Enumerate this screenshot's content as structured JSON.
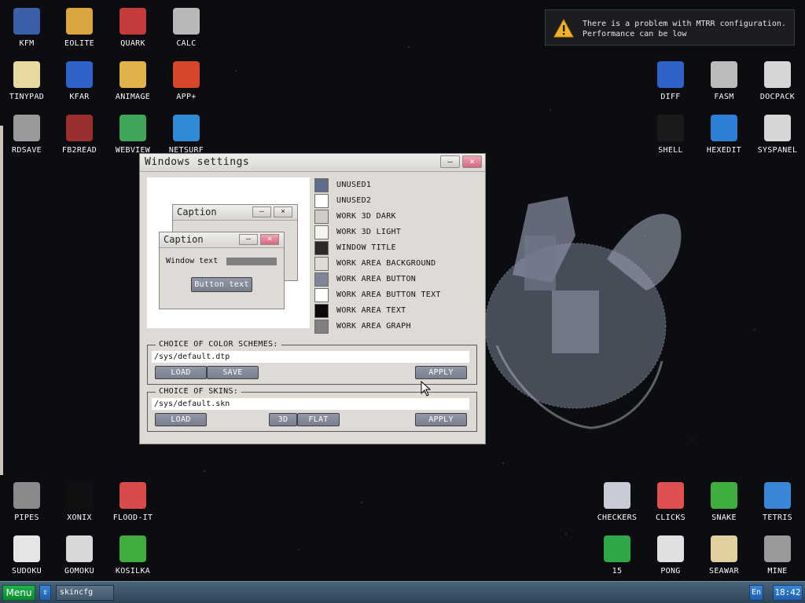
{
  "desktop": {
    "left_top_icons": [
      {
        "label": "KFM",
        "icon": "floppy-disk-icon",
        "color": "#3b5fa8"
      },
      {
        "label": "EOLITE",
        "icon": "folder-icon",
        "color": "#d9a640"
      },
      {
        "label": "QUARK",
        "icon": "notebook-icon",
        "color": "#c53a3a"
      },
      {
        "label": "CALC",
        "icon": "calculator-icon",
        "color": "#b8b8b8"
      },
      {
        "label": "TINYPAD",
        "icon": "notepad-icon",
        "color": "#e8d9a0"
      },
      {
        "label": "KFAR",
        "icon": "file-manager-icon",
        "color": "#2d63c8"
      },
      {
        "label": "ANIMAGE",
        "icon": "pencil-ruler-icon",
        "color": "#e0b24a"
      },
      {
        "label": "APP+",
        "icon": "rubiks-cube-icon",
        "color": "#d9472b"
      },
      {
        "label": "RDSAVE",
        "icon": "ramdisk-save-icon",
        "color": "#9a9a9a"
      },
      {
        "label": "FB2READ",
        "icon": "book-icon",
        "color": "#9a2f2f"
      },
      {
        "label": "WEBVIEW",
        "icon": "webview-map-icon",
        "color": "#3fa65a"
      },
      {
        "label": "NETSURF",
        "icon": "globe-icon",
        "color": "#2f8ad8"
      }
    ],
    "right_top_icons": [
      {
        "label": "DIFF",
        "icon": "diff-icon",
        "color": "#2d63c8"
      },
      {
        "label": "FASM",
        "icon": "fasm-icon",
        "color": "#bcbcbc"
      },
      {
        "label": "DOCPACK",
        "icon": "cabinet-icon",
        "color": "#d6d6d6"
      },
      {
        "label": "SHELL",
        "icon": "terminal-icon",
        "color": "#1a1a1a"
      },
      {
        "label": "HEXEDIT",
        "icon": "hex-editor-icon",
        "color": "#2d7fd8"
      },
      {
        "label": "SYSPANEL",
        "icon": "sliders-icon",
        "color": "#d6d6d6"
      }
    ],
    "bottom_left_icons": [
      {
        "label": "PIPES",
        "icon": "pipes-icon",
        "color": "#8a8a8a"
      },
      {
        "label": "XONIX",
        "icon": "xonix-icon",
        "color": "#101010"
      },
      {
        "label": "FLOOD-IT",
        "icon": "flood-it-icon",
        "color": "#d94b4b"
      },
      {
        "label": "SUDOKU",
        "icon": "sudoku-icon",
        "color": "#e6e6e6"
      },
      {
        "label": "GOMOKU",
        "icon": "gomoku-icon",
        "color": "#d8d8d8"
      },
      {
        "label": "KOSILKA",
        "icon": "lawnmower-icon",
        "color": "#3fae3f"
      }
    ],
    "bottom_right_icons": [
      {
        "label": "CHECKERS",
        "icon": "checkers-icon",
        "color": "#c8ccd6"
      },
      {
        "label": "CLICKS",
        "icon": "clicks-blocks-icon",
        "color": "#e05050"
      },
      {
        "label": "SNAKE",
        "icon": "snake-icon",
        "color": "#3fae3f"
      },
      {
        "label": "TETRIS",
        "icon": "tetris-icon",
        "color": "#3a86d8"
      },
      {
        "label": "15",
        "icon": "fifteen-puzzle-icon",
        "color": "#2fa84a"
      },
      {
        "label": "PONG",
        "icon": "pong-icon",
        "color": "#e0e0e0"
      },
      {
        "label": "SEAWAR",
        "icon": "seawar-icon",
        "color": "#e0d0a0"
      },
      {
        "label": "MINE",
        "icon": "mine-icon",
        "color": "#9a9a9a"
      }
    ]
  },
  "notification": {
    "icon": "warning-icon",
    "text": "There is a problem with MTRR configuration.\nPerformance can be low"
  },
  "window": {
    "title": "Windows settings",
    "minimize_glyph": "–",
    "close_glyph": "×",
    "preview": {
      "back_caption": "Caption",
      "front_caption": "Caption",
      "window_text": "Window text",
      "button_text": "Button text"
    },
    "colors": [
      {
        "label": "UNUSED1",
        "color": "#5e6d8c"
      },
      {
        "label": "UNUSED2",
        "color": "#ffffff"
      },
      {
        "label": "WORK 3D DARK",
        "color": "#cfcdc9"
      },
      {
        "label": "WORK 3D LIGHT",
        "color": "#f4f3f1"
      },
      {
        "label": "WINDOW TITLE",
        "color": "#2a2a2a"
      },
      {
        "label": "WORK AREA BACKGROUND",
        "color": "#dedbd6"
      },
      {
        "label": "WORK AREA BUTTON",
        "color": "#7f869a"
      },
      {
        "label": "WORK AREA BUTTON TEXT",
        "color": "#ffffff"
      },
      {
        "label": "WORK AREA TEXT",
        "color": "#0a0a0a"
      },
      {
        "label": "WORK AREA GRAPH",
        "color": "#808080"
      }
    ],
    "color_schemes": {
      "label": "CHOICE OF COLOR SCHEMES:",
      "path": "/sys/default.dtp",
      "load": "LOAD",
      "save": "SAVE",
      "apply": "APPLY"
    },
    "skins": {
      "label": "CHOICE OF SKINS:",
      "path": "/sys/default.skn",
      "load": "LOAD",
      "btn_3d": "3D",
      "flat": "FLAT",
      "apply": "APPLY"
    }
  },
  "taskbar": {
    "menu": "Menu",
    "switch_glyph": "⇕",
    "task": "skincfg",
    "lang": "En",
    "clock": "18:42"
  }
}
